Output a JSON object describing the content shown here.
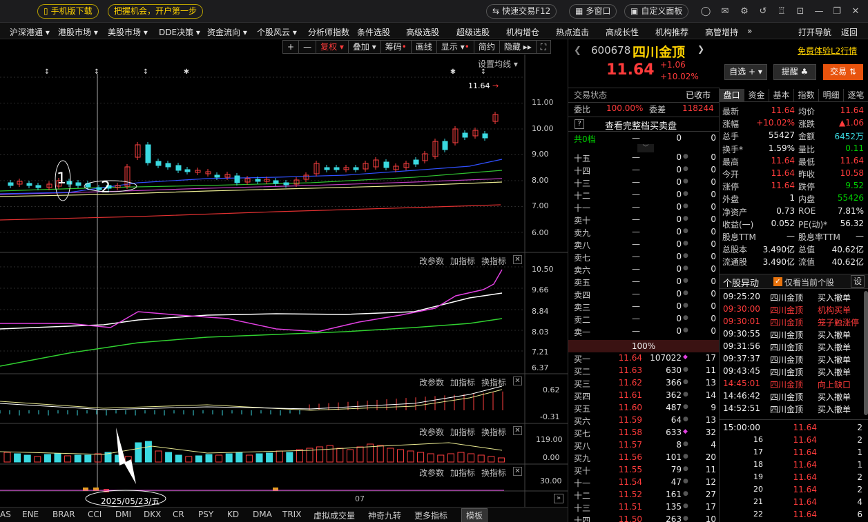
{
  "topbar": {
    "mobile_download": "手机版下载",
    "slogan": "把握机会，开户第一步",
    "quick_trade": "快速交易F12",
    "multi_window": "多窗口",
    "custom_panel": "自定义面板"
  },
  "menu": {
    "items": [
      "沪深港通",
      "港股市场",
      "美股市场",
      "DDE决策",
      "资金流向",
      "个股风云",
      "分析师指数",
      "条件选股",
      "高级选股",
      "超级选股",
      "机构增仓",
      "热点追击",
      "高成长性",
      "机构推荐",
      "高管增持"
    ],
    "more": "»",
    "open_nav": "打开导航",
    "back": "返回"
  },
  "chart_toolbar": {
    "plus": "+",
    "minus": "—",
    "fuquan": "复权",
    "overlay": "叠加",
    "chips": "筹码",
    "draw": "画线",
    "display": "显示",
    "simple": "简约",
    "hide": "隐藏"
  },
  "main_panel": {
    "settings_ma": "设置均线",
    "last_price_label": "11.64",
    "y_ticks": [
      "11.00",
      "10.00",
      "9.00",
      "8.00",
      "7.00",
      "6.00"
    ],
    "annotations": [
      "1",
      "2"
    ]
  },
  "indicator_panels": [
    {
      "edit": "改参数",
      "add": "加指标",
      "switch": "换指标",
      "y_ticks": [
        "10.50",
        "9.66",
        "8.84",
        "8.03",
        "7.21",
        "6.37"
      ]
    },
    {
      "edit": "改参数",
      "add": "加指标",
      "switch": "换指标",
      "y_ticks": [
        "0.62",
        "-0.31"
      ]
    },
    {
      "edit": "改参数",
      "add": "加指标",
      "switch": "换指标",
      "y_ticks": [
        "119.00",
        "0.00"
      ]
    },
    {
      "edit": "改参数",
      "add": "加指标",
      "switch": "换指标",
      "y_ticks": [
        "30.00"
      ]
    }
  ],
  "x_axis": {
    "cursor_date": "2025/05/23/五",
    "month": "07"
  },
  "bottom_tabs": [
    "AS",
    "ENE",
    "BRAR",
    "CCI",
    "DMI",
    "DKX",
    "CR",
    "PSY",
    "KD",
    "DMA",
    "TRIX",
    "虚拟成交量",
    "神奇九转",
    "更多指标",
    "模板"
  ],
  "stock": {
    "code": "600678",
    "name": "四川金顶",
    "promo": "免费体验L2行情",
    "price": "11.64",
    "change": "+1.06",
    "change_pct": "+10.02%",
    "btn_watch": "自选",
    "btn_alert": "提醒",
    "btn_trade": "交易"
  },
  "trade_status": {
    "label": "交易状态",
    "value": "已收市"
  },
  "weibi": {
    "label1": "委比",
    "v1": "100.00%",
    "label2": "委差",
    "v2": "118244"
  },
  "full_book": "查看完整档买卖盘",
  "zero_tier": {
    "label": "共0档",
    "dash": "—",
    "a": "0",
    "b": "0"
  },
  "sell_rows": [
    [
      "十五",
      "—",
      "0",
      "0"
    ],
    [
      "十四",
      "—",
      "0",
      "0"
    ],
    [
      "十三",
      "—",
      "0",
      "0"
    ],
    [
      "十二",
      "—",
      "0",
      "0"
    ],
    [
      "十一",
      "—",
      "0",
      "0"
    ],
    [
      "卖十",
      "—",
      "0",
      "0"
    ],
    [
      "卖九",
      "—",
      "0",
      "0"
    ],
    [
      "卖八",
      "—",
      "0",
      "0"
    ],
    [
      "卖七",
      "—",
      "0",
      "0"
    ],
    [
      "卖六",
      "—",
      "0",
      "0"
    ],
    [
      "卖五",
      "—",
      "0",
      "0"
    ],
    [
      "卖四",
      "—",
      "0",
      "0"
    ],
    [
      "卖三",
      "—",
      "0",
      "0"
    ],
    [
      "卖二",
      "—",
      "0",
      "0"
    ],
    [
      "卖一",
      "—",
      "0",
      "0"
    ]
  ],
  "bid_ratio": "100%",
  "buy_rows": [
    [
      "买一",
      "11.64",
      "107022",
      "17"
    ],
    [
      "买二",
      "11.63",
      "630",
      "11"
    ],
    [
      "买三",
      "11.62",
      "366",
      "13"
    ],
    [
      "买四",
      "11.61",
      "362",
      "14"
    ],
    [
      "买五",
      "11.60",
      "487",
      "9"
    ],
    [
      "买六",
      "11.59",
      "64",
      "13"
    ],
    [
      "买七",
      "11.58",
      "633",
      "32"
    ],
    [
      "买八",
      "11.57",
      "8",
      "4"
    ],
    [
      "买九",
      "11.56",
      "101",
      "20"
    ],
    [
      "买十",
      "11.55",
      "79",
      "11"
    ],
    [
      "十一",
      "11.54",
      "47",
      "12"
    ],
    [
      "十二",
      "11.52",
      "161",
      "27"
    ],
    [
      "十三",
      "11.51",
      "135",
      "17"
    ],
    [
      "十四",
      "11.50",
      "263",
      "10"
    ]
  ],
  "right_tabs": [
    "盘口",
    "资金",
    "基本",
    "指数",
    "明细",
    "逐笔"
  ],
  "quote": [
    [
      "最新",
      "11.64",
      "均价",
      "11.64"
    ],
    [
      "涨幅",
      "+10.02%",
      "涨跌",
      "▲1.06"
    ],
    [
      "总手",
      "55427",
      "金额",
      "6452万"
    ],
    [
      "换手*",
      "1.59%",
      "量比",
      "0.11"
    ],
    [
      "最高",
      "11.64",
      "最低",
      "11.64"
    ],
    [
      "今开",
      "11.64",
      "昨收",
      "10.58"
    ],
    [
      "涨停",
      "11.64",
      "跌停",
      "9.52"
    ],
    [
      "外盘",
      "1",
      "内盘",
      "55426"
    ],
    [
      "净资产",
      "0.73",
      "ROE",
      "7.81%"
    ],
    [
      "收益(一)",
      "0.052",
      "PE(动)*",
      "56.32"
    ],
    [
      "股息TTM",
      "—",
      "股息率TTM",
      "—"
    ],
    [
      "总股本",
      "3.490亿",
      "总值",
      "40.62亿"
    ],
    [
      "流通股",
      "3.490亿",
      "流值",
      "40.62亿"
    ]
  ],
  "movement": {
    "title": "个股异动",
    "only_current": "仅看当前个股",
    "settings": "设",
    "rows": [
      [
        "09:25:20",
        "四川金顶",
        "买入撤单"
      ],
      [
        "09:30:00",
        "四川金顶",
        "机构买单"
      ],
      [
        "09:30:01",
        "四川金顶",
        "笼子触涨停"
      ],
      [
        "09:30:55",
        "四川金顶",
        "买入撤单"
      ],
      [
        "09:31:56",
        "四川金顶",
        "买入撤单"
      ],
      [
        "09:37:37",
        "四川金顶",
        "买入撤单"
      ],
      [
        "09:43:45",
        "四川金顶",
        "买入撤单"
      ],
      [
        "14:45:01",
        "四川金顶",
        "向上缺口"
      ],
      [
        "14:46:42",
        "四川金顶",
        "买入撤单"
      ],
      [
        "14:52:51",
        "四川金顶",
        "买入撤单"
      ]
    ]
  },
  "ticks": [
    [
      "15:00:00",
      "11.64",
      "2"
    ],
    [
      "16",
      "11.64",
      "2"
    ],
    [
      "17",
      "11.64",
      "1"
    ],
    [
      "18",
      "11.64",
      "1"
    ],
    [
      "19",
      "11.64",
      "2"
    ],
    [
      "20",
      "11.64",
      "2"
    ],
    [
      "21",
      "11.64",
      "4"
    ],
    [
      "22",
      "11.64",
      "6"
    ]
  ]
}
